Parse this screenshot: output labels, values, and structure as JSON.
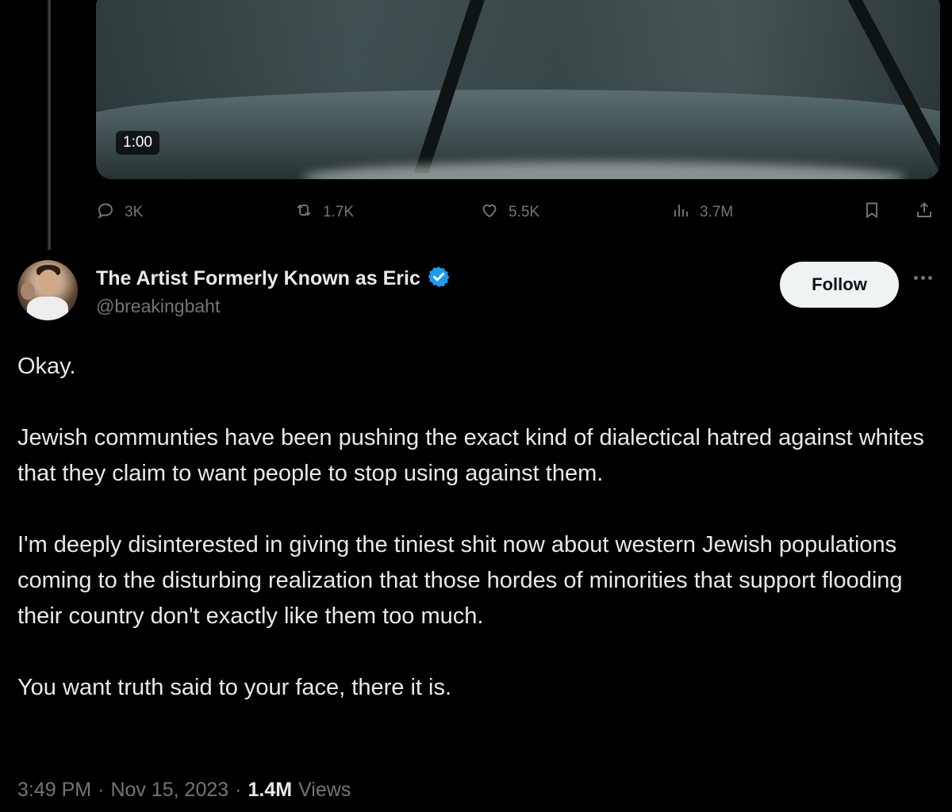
{
  "video": {
    "duration": "1:00"
  },
  "actions": {
    "replies": "3K",
    "reposts": "1.7K",
    "likes": "5.5K",
    "views": "3.7M"
  },
  "author": {
    "display_name": "The Artist Formerly Known as Eric",
    "handle": "@breakingbaht",
    "verified": true
  },
  "follow_label": "Follow",
  "tweet": {
    "paragraphs": [
      "Okay.",
      "Jewish communties have been pushing the exact kind of dialectical hatred against whites that they claim to want people to stop using against them.",
      "I'm deeply disinterested in giving the tiniest shit now about western Jewish populations coming to the disturbing realization that those hordes of minorities that support flooding their country don't exactly like them too much.",
      "You want truth said to your face, there it is."
    ]
  },
  "meta": {
    "time": "3:49 PM",
    "separator": "·",
    "date": "Nov 15, 2023",
    "views_count": "1.4M",
    "views_label": "Views"
  },
  "colors": {
    "background": "#000000",
    "text": "#e7e9ea",
    "secondary": "#71767b",
    "verified": "#1d9bf0",
    "follow_bg": "#eff3f4"
  },
  "icons": [
    "reply-icon",
    "repost-icon",
    "like-icon",
    "views-icon",
    "bookmark-icon",
    "share-icon",
    "verified-badge-icon",
    "more-icon"
  ]
}
